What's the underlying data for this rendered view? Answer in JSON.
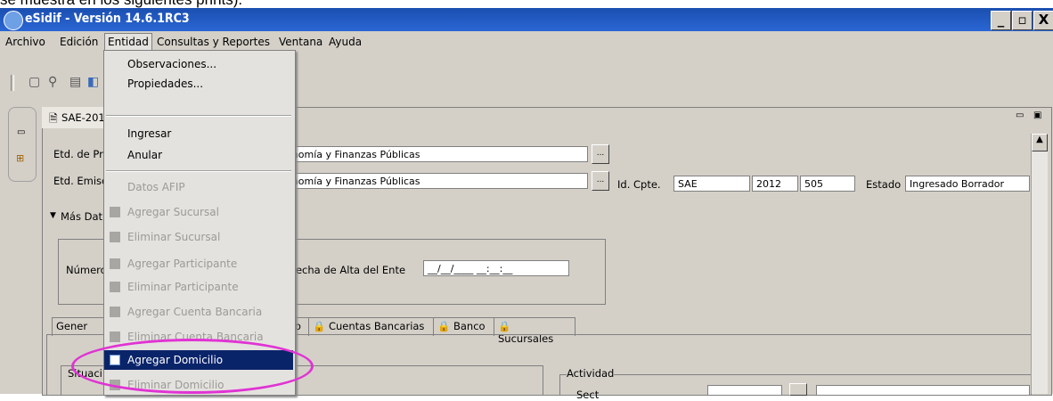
{
  "overlay_text": "se muestra en los siguientes prints).",
  "window": {
    "title": "eSidif - Versión 14.6.1RC3",
    "buttons": [
      "_",
      "▫",
      "X"
    ]
  },
  "menubar": [
    "Archivo",
    "Edición",
    "Entidad",
    "Consultas y Reportes",
    "Ventana",
    "Ayuda"
  ],
  "perspective": {
    "label": "eSidif"
  },
  "editor_tab": {
    "label": "SAE-201"
  },
  "form": {
    "etd_prop_label": "Etd. de Pr",
    "etd_prop_value": "conomía y Finanzas Públicas",
    "etd_emis_label": "Etd. Emisc",
    "etd_emis_value": "conomía y Finanzas Públicas",
    "btn_dots": "...",
    "id_cpte_label": "Id. Cpte.",
    "id_cpte_tipo": "SAE",
    "id_cpte_anio": "2012",
    "id_cpte_num": "505",
    "estado_label": "Estado",
    "estado_value": "Ingresado Borrador",
    "mas_datos": "Más Dat",
    "numero_label": "Número",
    "fecha_alta_label": "Fecha de Alta del Ente",
    "fecha_alta_value": "__/__/____ __:__:__",
    "situacion_label": "Situaci",
    "actividad_label": "Actividad",
    "sector_label": "Sect"
  },
  "subtabs": [
    "Gener",
    "rio",
    "Cuentas Bancarias",
    "Banco",
    "Sucursales"
  ],
  "entidad_menu": {
    "items": [
      {
        "label": "Observaciones...",
        "enabled": true
      },
      {
        "label": "Propiedades...",
        "enabled": true
      },
      {
        "label": "Ingresar",
        "enabled": true
      },
      {
        "label": "Anular",
        "enabled": true
      },
      {
        "label": "Datos AFIP",
        "enabled": false
      },
      {
        "label": "Agregar Sucursal",
        "enabled": false
      },
      {
        "label": "Eliminar Sucursal",
        "enabled": false
      },
      {
        "label": "Agregar Participante",
        "enabled": false
      },
      {
        "label": "Eliminar Participante",
        "enabled": false
      },
      {
        "label": "Agregar Cuenta Bancaria",
        "enabled": false
      },
      {
        "label": "Eliminar Cuenta Bancaria",
        "enabled": false
      },
      {
        "label": "Agregar Domicilio",
        "enabled": true,
        "highlighted": true
      },
      {
        "label": "Eliminar Domicilio",
        "enabled": false
      }
    ]
  },
  "colors": {
    "titlebar": "#1b4fb0",
    "highlight": "#0a246a",
    "annotation": "#e033d4"
  }
}
